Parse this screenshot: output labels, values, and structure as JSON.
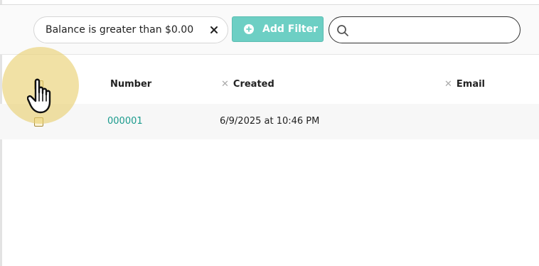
{
  "toolbar": {
    "filter_chip": {
      "label": "Balance is greater than $0.00",
      "close_icon": "close-icon"
    },
    "add_filter": {
      "label": "Add Filter",
      "icon": "plus-circle-icon"
    },
    "search": {
      "value": "",
      "placeholder": "",
      "icon": "search-icon"
    }
  },
  "table": {
    "columns": [
      {
        "label": "Number",
        "removable": false
      },
      {
        "label": "Created",
        "removable": true
      },
      {
        "label": "Email",
        "removable": true
      }
    ],
    "rows": [
      {
        "number": "000001",
        "created": "6/9/2025 at 10:46 PM",
        "email": ""
      }
    ]
  },
  "colors": {
    "accent": "#6dcfc4",
    "link": "#199a8c",
    "click_highlight": "#e8ce6e"
  }
}
